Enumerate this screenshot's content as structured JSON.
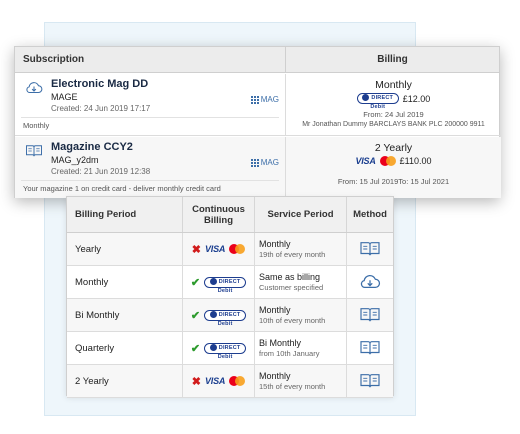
{
  "card": {
    "headers": {
      "subscription": "Subscription",
      "billing": "Billing"
    },
    "rows": [
      {
        "name": "Electronic Mag DD",
        "code": "MAGE",
        "created": "Created: 24 Jun 2019 17:17",
        "tag": "MAG",
        "note": "Monthly",
        "icon": "cloud-download-icon",
        "billing": {
          "frequency": "Monthly",
          "method": "direct-debit",
          "amount": "£12.00",
          "from": "From: 24 Jul 2019",
          "account": "Mr Jonathan Dummy BARCLAYS BANK PLC 200000 9911"
        }
      },
      {
        "name": "Magazine CCY2",
        "code": "MAG_y2dm",
        "created": "Created: 21 Jun 2019 12:38",
        "tag": "MAG",
        "note": "Your magazine 1 on credit card - deliver monthly credit card",
        "icon": "open-book-icon",
        "billing": {
          "frequency": "2 Yearly",
          "method": "card",
          "amount": "£110.00",
          "from": "From: 15 Jul 2019To: 15 Jul 2021"
        }
      }
    ]
  },
  "table": {
    "headers": {
      "billing_period": "Billing Period",
      "continuous_billing": "Continuous Billing",
      "service_period": "Service Period",
      "method": "Method"
    },
    "rows": [
      {
        "period": "Yearly",
        "continuous": false,
        "pay": "card",
        "service_1": "Monthly",
        "service_2": "19th of every month",
        "method_icon": "open-book-icon"
      },
      {
        "period": "Monthly",
        "continuous": true,
        "pay": "direct-debit",
        "service_1": "Same as billing",
        "service_2": "Customer specified",
        "method_icon": "cloud-download-icon"
      },
      {
        "period": "Bi Monthly",
        "continuous": true,
        "pay": "direct-debit",
        "service_1": "Monthly",
        "service_2": "10th of every month",
        "method_icon": "open-book-icon"
      },
      {
        "period": "Quarterly",
        "continuous": true,
        "pay": "direct-debit",
        "service_1": "Bi Monthly",
        "service_2": "from 10th January",
        "method_icon": "open-book-icon"
      },
      {
        "period": "2 Yearly",
        "continuous": false,
        "pay": "card",
        "service_1": "Monthly",
        "service_2": "15th of every month",
        "method_icon": "open-book-icon"
      }
    ]
  },
  "labels": {
    "visa": "VISA",
    "direct_debit": "DIRECT Debit",
    "check": "✔",
    "cross": "✖"
  },
  "colors": {
    "accent_blue": "#1d3d8f",
    "ok_green": "#2d9b2d",
    "no_red": "#d11b1b"
  }
}
